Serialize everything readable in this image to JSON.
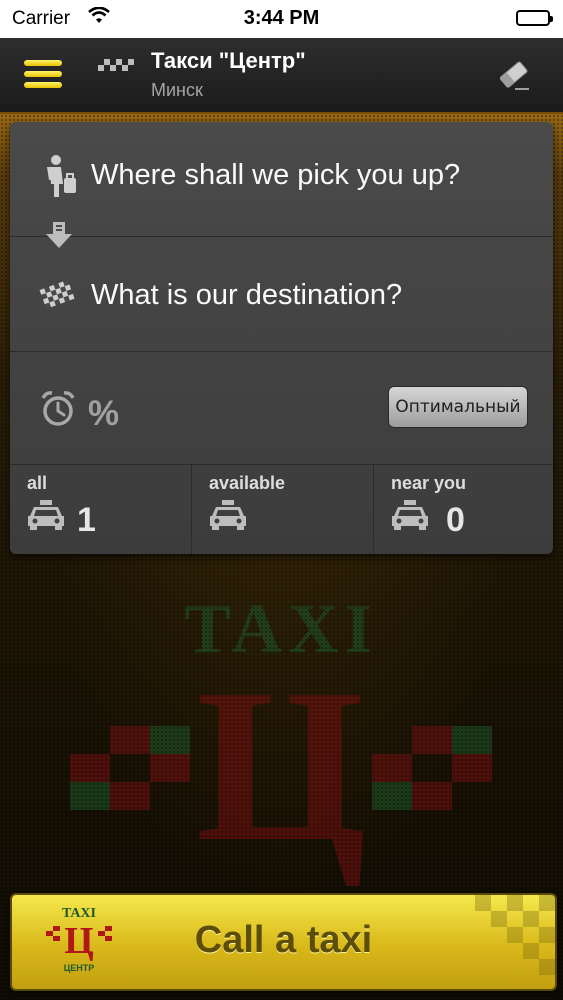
{
  "status_bar": {
    "carrier": "Carrier",
    "time": "3:44 PM"
  },
  "nav": {
    "title": "Такси \"Центр\"",
    "subtitle": "Минск",
    "menu_icon": "hamburger-menu-icon",
    "clear_icon": "eraser-icon"
  },
  "order": {
    "pickup_text": "Where shall we pick you up?",
    "destination_text": "What is our destination?",
    "percent": "%",
    "mode_label": "Оптимальный"
  },
  "stats": [
    {
      "label": "all",
      "count": "1"
    },
    {
      "label": "available",
      "count": ""
    },
    {
      "label": "near you",
      "count": "0"
    }
  ],
  "call": {
    "label": "Call a taxi"
  },
  "logo": {
    "top_text": "TAXI",
    "letter": "Ц",
    "bottom_text": "ЦЕНТР"
  },
  "colors": {
    "accent_yellow": "#f0d800",
    "card_bg": "#444444",
    "logo_green": "#1f5a2a",
    "logo_red": "#7a1010"
  }
}
